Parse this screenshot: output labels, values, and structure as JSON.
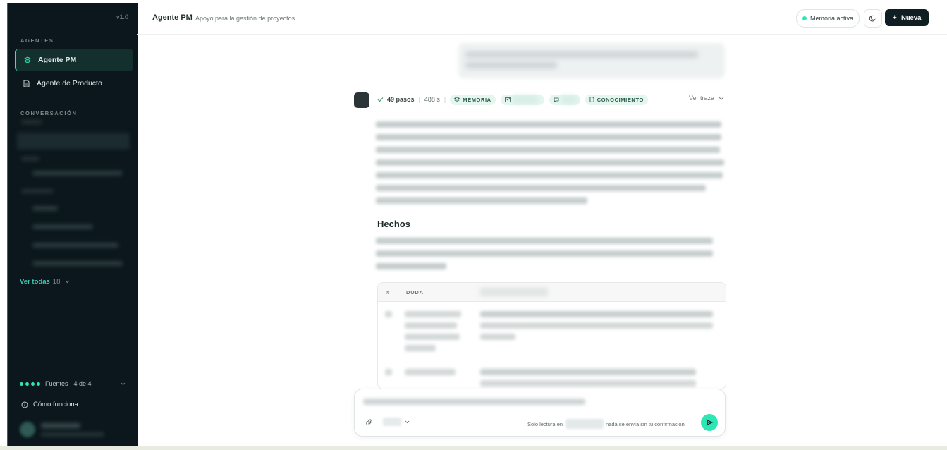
{
  "sidebar": {
    "version": "v1.0",
    "section_agents": "AGENTES",
    "agents": [
      {
        "label": "Agente PM",
        "icon": "layers-icon",
        "active": true
      },
      {
        "label": "Agente de Producto",
        "icon": "document-icon",
        "active": false
      }
    ],
    "section_conversation": "CONVERSACIÓN",
    "see_all": "Ver todas",
    "see_all_count": "18",
    "sources": "Fuentes · 4 de 4",
    "how_it_works": "Cómo funciona"
  },
  "header": {
    "title": "Agente PM",
    "subtitle": "Apoyo para la gestión de proyectos",
    "memory_label": "Memoria activa",
    "new_label": "Nueva"
  },
  "message": {
    "steps": "49 pasos",
    "duration": "488 s",
    "pill_memory": "MEMORIA",
    "pill_knowledge": "CONOCIMIENTO",
    "trace_label": "Ver traza",
    "section_title": "Hechos",
    "table_columns": [
      "#",
      "DUDA"
    ]
  },
  "composer": {
    "note_prefix": "Solo lectura en",
    "note_suffix": "nada se envía sin tu confirmación"
  },
  "colors": {
    "accent": "#2ee6b5",
    "sidebar_bg": "#0b171c",
    "primary_button": "#0f1e22"
  }
}
